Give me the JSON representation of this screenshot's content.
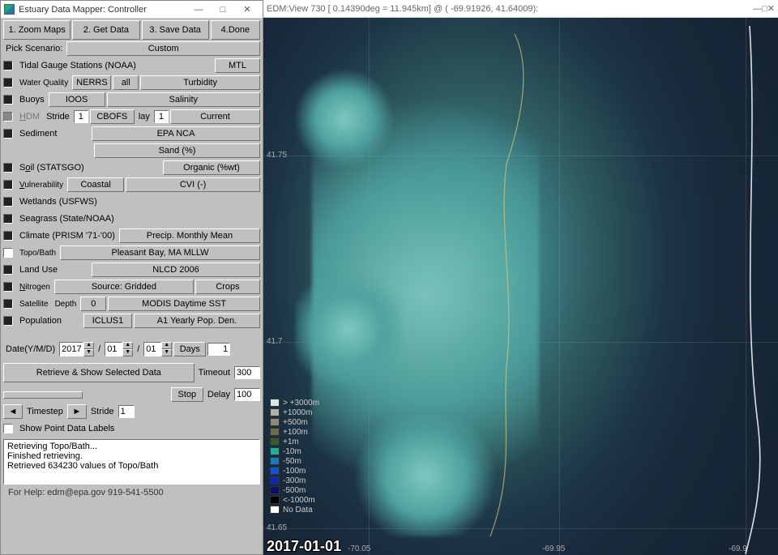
{
  "controller": {
    "title": "Estuary Data Mapper: Controller",
    "steps": {
      "s1": "1. Zoom Maps",
      "s2": "2. Get Data",
      "s3": "3. Save Data",
      "s4": "4.Done"
    },
    "pick_scenario_label": "Pick Scenario:",
    "pick_scenario_value": "Custom",
    "rows": {
      "tidal_label": "Tidal Gauge Stations (NOAA)",
      "tidal_opt": "MTL",
      "wq_label": "Water Quality",
      "wq_src": "NERRS",
      "wq_scope": "all",
      "wq_param": "Turbidity",
      "buoys_label": "Buoys",
      "buoys_src": "IOOS",
      "buoys_param": "Salinity",
      "hdm_label": "HDM",
      "hdm_stride_lbl": "Stride",
      "hdm_stride_val": "1",
      "hdm_model": "CBOFS",
      "hdm_lay_lbl": "lay",
      "hdm_lay_val": "1",
      "hdm_param": "Current",
      "sed_label": "Sediment",
      "sed_src": "EPA NCA",
      "sed_param": "Sand (%)",
      "soil_label": "Soil (STATSGO)",
      "soil_param": "Organic (%wt)",
      "vuln_label": "Vulnerability",
      "vuln_scope": "Coastal",
      "vuln_param": "CVI (-)",
      "wet_label": "Wetlands (USFWS)",
      "seagrass_label": "Seagrass (State/NOAA)",
      "climate_label": "Climate (PRISM '71-'00)",
      "climate_param": "Precip. Monthly Mean",
      "topo_label": "Topo/Bath",
      "topo_val": "Pleasant Bay, MA MLLW",
      "landuse_label": "Land Use",
      "landuse_val": "NLCD 2006",
      "nitro_label": "Nitrogen",
      "nitro_src": "Source: Gridded",
      "nitro_param": "Crops",
      "sat_label": "Satellite",
      "sat_depth_lbl": "Depth",
      "sat_depth_val": "0",
      "sat_param": "MODIS Daytime SST",
      "pop_label": "Population",
      "pop_src": "ICLUS1",
      "pop_param": "A1 Yearly Pop. Den."
    },
    "date_label": "Date(Y/M/D)",
    "date_y": "2017",
    "date_m": "01",
    "date_d": "01",
    "date_slash": "/",
    "days_label": "Days",
    "days_val": "1",
    "retrieve_btn": "Retrieve & Show Selected Data",
    "timeout_label": "Timeout",
    "timeout_val": "300",
    "stop_btn": "Stop",
    "delay_label": "Delay",
    "delay_val": "100",
    "timestep_label": "Timestep",
    "stride2_label": "Stride",
    "stride2_val": "1",
    "show_labels": "Show Point Data Labels",
    "log_text": "Retrieving Topo/Bath...\nFinished retrieving.\nRetrieved 634230 values of Topo/Bath",
    "help_text": "For Help: edm@epa.gov 919-541-5500"
  },
  "mapview": {
    "title": "EDM:View 730 [ 0.14390deg =    11.945km] @ ( -69.91926, 41.64009):",
    "grid_x": [
      "-70.05",
      "-69.95",
      "-69.9"
    ],
    "grid_y": [
      "41.75",
      "41.7",
      "41.65"
    ],
    "legend": [
      {
        "label": "> +3000m",
        "color": "#d8e8e8"
      },
      {
        "label": "+1000m",
        "color": "#b0b0a8"
      },
      {
        "label": "+500m",
        "color": "#8c8c76"
      },
      {
        "label": "+100m",
        "color": "#6c6c4d"
      },
      {
        "label": "+1m",
        "color": "#3a5a2a"
      },
      {
        "label": "-10m",
        "color": "#1fae9a"
      },
      {
        "label": "-50m",
        "color": "#1878c0"
      },
      {
        "label": "-100m",
        "color": "#1450d8"
      },
      {
        "label": "-300m",
        "color": "#1028b0"
      },
      {
        "label": "-500m",
        "color": "#0a106a"
      },
      {
        "label": "<-1000m",
        "color": "#000000"
      },
      {
        "label": "No Data",
        "color": "#ffffff"
      }
    ],
    "datestamp": "2017-01-01"
  }
}
